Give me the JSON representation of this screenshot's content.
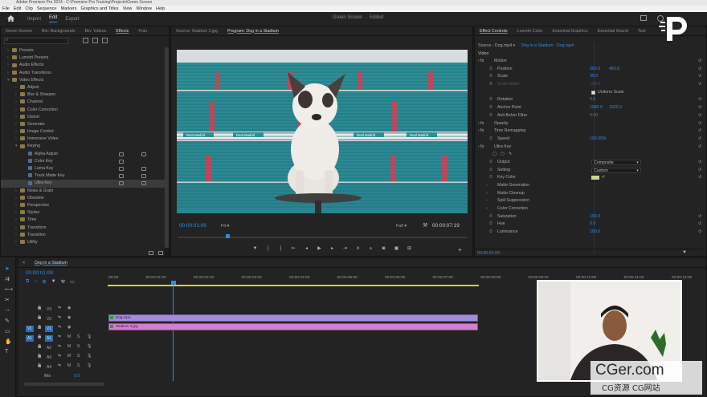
{
  "titlebar": {
    "text": "Adobe Premiere Pro 2024 - C:\\Premiere Pro Training\\Projects\\Green Screen"
  },
  "menu": [
    "File",
    "Edit",
    "Clip",
    "Sequence",
    "Markers",
    "Graphics and Titles",
    "View",
    "Window",
    "Help"
  ],
  "header": {
    "tabs": [
      "Import",
      "Edit",
      "Export"
    ],
    "active": "Edit",
    "project": "Green Screen",
    "status": "Edited"
  },
  "left_panel": {
    "tabs": [
      "Green Screen",
      "Bin: Backgrounds",
      "Bin: Videos",
      "Effects",
      "Fran"
    ],
    "active": "Effects",
    "tree": [
      {
        "label": "Presets",
        "level": 0
      },
      {
        "label": "Lumetri Presets",
        "level": 0
      },
      {
        "label": "Audio Effects",
        "level": 0
      },
      {
        "label": "Audio Transitions",
        "level": 0
      },
      {
        "label": "Video Effects",
        "level": 0,
        "open": true
      },
      {
        "label": "Adjust",
        "level": 1
      },
      {
        "label": "Blur & Sharpen",
        "level": 1
      },
      {
        "label": "Channel",
        "level": 1
      },
      {
        "label": "Color Correction",
        "level": 1
      },
      {
        "label": "Distort",
        "level": 1
      },
      {
        "label": "Generate",
        "level": 1
      },
      {
        "label": "Image Control",
        "level": 1
      },
      {
        "label": "Immersive Video",
        "level": 1
      },
      {
        "label": "Keying",
        "level": 1,
        "open": true
      },
      {
        "label": "Alpha Adjust",
        "level": 2
      },
      {
        "label": "Color Key",
        "level": 2
      },
      {
        "label": "Luma Key",
        "level": 2
      },
      {
        "label": "Track Matte Key",
        "level": 2
      },
      {
        "label": "Ultra Key",
        "level": 2,
        "selected": true
      },
      {
        "label": "Noise & Grain",
        "level": 1
      },
      {
        "label": "Obsolete",
        "level": 1
      },
      {
        "label": "Perspective",
        "level": 1
      },
      {
        "label": "Stylize",
        "level": 1
      },
      {
        "label": "Time",
        "level": 1
      },
      {
        "label": "Transform",
        "level": 1
      },
      {
        "label": "Transition",
        "level": 1
      },
      {
        "label": "Utility",
        "level": 1
      }
    ]
  },
  "monitor": {
    "tabs": [
      "Source: Stadium 2.jpg",
      "Program: Dog in a Stadium"
    ],
    "active": "Program: Dog in a Stadium",
    "timecode": "00:00:01:09",
    "fit": "Fit",
    "quality": "Full",
    "duration": "00:00:07:19",
    "banners": [
      "Real Madrid",
      "Real Madrid",
      "Real Madrid",
      "Real Madrid",
      "Real Madrid"
    ]
  },
  "effect_controls": {
    "tabs": [
      "Effect Controls",
      "Lumetri Color",
      "Essential Graphics",
      "Essential Sound",
      "Text"
    ],
    "source": "Source - Dog.mp4",
    "clip": "Dog in a Stadium - Dog.mp4",
    "section": "Video",
    "rows": [
      {
        "label": "Motion",
        "kind": "fx"
      },
      {
        "label": "Position",
        "v1": "960.0",
        "v2": "483.8"
      },
      {
        "label": "Scale",
        "v1": "39.0"
      },
      {
        "label": "Scale Width",
        "v1": "100.0",
        "dim": true
      },
      {
        "label": "",
        "check": "Uniform Scale"
      },
      {
        "label": "Rotation",
        "v1": "0.0"
      },
      {
        "label": "Anchor Point",
        "v1": "1080.0",
        "v2": "1920.0"
      },
      {
        "label": "Anti-flicker Filter",
        "v1": "0.00"
      },
      {
        "label": "Opacity",
        "kind": "fx"
      },
      {
        "label": "Time Remapping",
        "kind": "fx"
      },
      {
        "label": "Speed",
        "v1": "100.00%"
      },
      {
        "label": "Ultra Key",
        "kind": "fx"
      },
      {
        "label": "",
        "kind": "icons"
      },
      {
        "label": "Output",
        "sel": "Composite"
      },
      {
        "label": "Setting",
        "sel": "Custom"
      },
      {
        "label": "Key Color",
        "swatch": "#c8d890"
      },
      {
        "label": "Matte Generation",
        "kind": "sub"
      },
      {
        "label": "Matte Cleanup",
        "kind": "sub"
      },
      {
        "label": "Spill Suppression",
        "kind": "sub"
      },
      {
        "label": "Color Correction",
        "kind": "sub"
      },
      {
        "label": "Saturation",
        "v1": "100.0"
      },
      {
        "label": "Hue",
        "v1": "0.0"
      },
      {
        "label": "Luminance",
        "v1": "100.0"
      }
    ],
    "footer_time": "00:00:01:09"
  },
  "timeline": {
    "title": "Dog in a Stadium",
    "timecode": "00:00:01:09",
    "ruler": [
      ":00:00",
      "00:00:01:00",
      "00:00:02:00",
      "00:00:03:00",
      "00:00:04:00",
      "00:00:05:00",
      "00:00:06:00",
      "00:00:07:00",
      "00:00:08:00",
      "00:00:09:00",
      "00:00:10:00",
      "00:00:11:00",
      "00:00:12:00"
    ],
    "tracks": [
      {
        "name": "V3",
        "type": "video"
      },
      {
        "name": "V2",
        "type": "video"
      },
      {
        "name": "V1",
        "type": "video",
        "src": "V1"
      },
      {
        "name": "A1",
        "type": "audio",
        "src": "A1"
      },
      {
        "name": "A2",
        "type": "audio"
      },
      {
        "name": "A3",
        "type": "audio"
      },
      {
        "name": "A4",
        "type": "audio"
      }
    ],
    "mix": {
      "label": "Mix",
      "value": "0.0"
    },
    "clips": [
      {
        "label": "Dog.mp4",
        "color": "#a38bd9"
      },
      {
        "label": "Stadium 2.jpg",
        "color": "#d37ed0"
      }
    ]
  },
  "watermark": {
    "big": "CGer.com",
    "small": "CG资源 CG网站"
  },
  "colors": {
    "accent": "#2d8ceb",
    "playhead": "#2d8ceb"
  }
}
